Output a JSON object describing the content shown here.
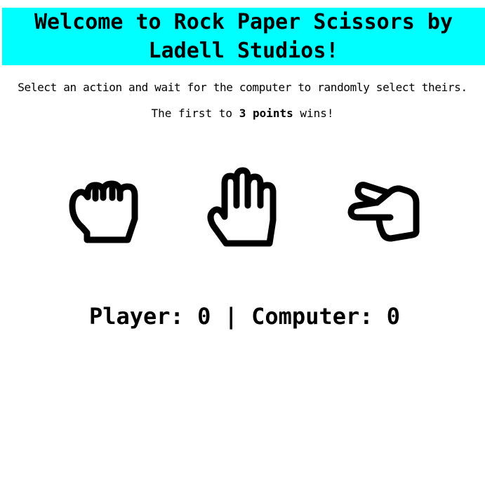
{
  "header": {
    "title": "Welcome to Rock Paper Scissors by Ladell Studios!",
    "background_color": "#00ffff"
  },
  "instructions": {
    "line1": "Select an action and wait for the computer to randomly select theirs.",
    "line2_prefix": "The first to ",
    "line2_bold": "3 points",
    "line2_suffix": " wins!"
  },
  "choices": [
    {
      "name": "rock",
      "icon": "fist-icon"
    },
    {
      "name": "paper",
      "icon": "open-hand-icon"
    },
    {
      "name": "scissors",
      "icon": "two-fingers-hand-icon"
    }
  ],
  "scoreboard": {
    "player_label": "Player:",
    "player_score": "0",
    "separator": "|",
    "computer_label": "Computer:",
    "computer_score": "0"
  }
}
